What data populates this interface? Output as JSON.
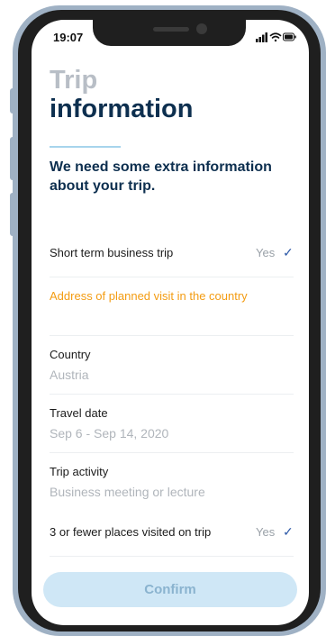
{
  "status_bar": {
    "time": "19:07",
    "icons": [
      "signal-icon",
      "wifi-icon",
      "battery-icon"
    ]
  },
  "header": {
    "title_line1": "Trip",
    "title_line2": "information"
  },
  "subtitle": "We need some extra information about your trip.",
  "business_trip": {
    "label": "Short term business trip",
    "value": "Yes"
  },
  "address_section": {
    "heading": "Address of planned visit in the country"
  },
  "fields": {
    "country": {
      "label": "Country",
      "value": "Austria"
    },
    "travel_date": {
      "label": "Travel date",
      "value": "Sep 6 - Sep 14, 2020"
    },
    "trip_activity": {
      "label": "Trip activity",
      "value": "Business meeting or lecture"
    }
  },
  "places_visited": {
    "label": "3 or fewer places visited on trip",
    "value": "Yes"
  },
  "confirm_label": "Confirm",
  "colors": {
    "accent_orange": "#f39c12",
    "navy": "#0d2f4f",
    "check_blue": "#2e5aa8",
    "button_bg": "#cfe7f6"
  }
}
